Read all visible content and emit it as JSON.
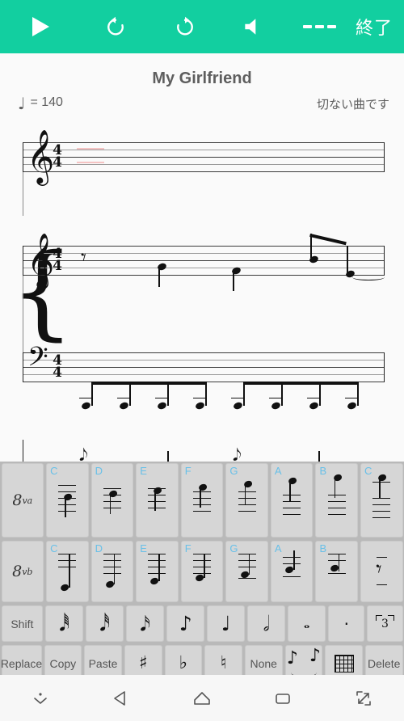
{
  "toolbar": {
    "play_label": "play-icon",
    "undo_label": "undo-icon",
    "redo_label": "redo-icon",
    "volume_label": "volume-icon",
    "dashes_label": "---",
    "exit_label": "終了",
    "background_color": "#12CFA0"
  },
  "score": {
    "title": "My Girlfriend",
    "tempo_note": "♩",
    "tempo_text": "= 140",
    "subtitle": "切ない曲です",
    "systems": [
      {
        "clef": "treble",
        "time_signature_top": "4",
        "time_signature_bottom": "4",
        "content": "empty measure with edit cursor"
      },
      {
        "clef": "treble",
        "time_signature_top": "4",
        "time_signature_bottom": "4",
        "content": "quarter rest, two quarter notes, two beamed eighth notes with tie"
      },
      {
        "clef": "bass",
        "time_signature_top": "4",
        "time_signature_bottom": "4",
        "content": "eight beamed eighth notes on ledger lines below staff"
      }
    ]
  },
  "keyboard": {
    "row_octave_up": {
      "octave_label": "8",
      "octave_sup": "va",
      "notes": [
        "C",
        "D",
        "E",
        "F",
        "G",
        "A",
        "B",
        "C"
      ]
    },
    "row_octave_down": {
      "octave_label": "8",
      "octave_sup": "vb",
      "notes": [
        "C",
        "D",
        "E",
        "F",
        "G",
        "A",
        "B"
      ],
      "rest_key": "quarter-rest"
    },
    "row_durations": {
      "shift_label": "Shift",
      "durations": [
        "sixty-fourth-note",
        "thirty-second-note",
        "sixteenth-note",
        "eighth-note",
        "quarter-note",
        "half-note",
        "whole-note",
        "dot",
        "triplet"
      ],
      "duration_glyphs": [
        "♬",
        "♬",
        "♫",
        "♪",
        "♩",
        "ᴕE",
        "ᴕD",
        "·",
        "3"
      ]
    },
    "row_actions": {
      "buttons": [
        {
          "name": "replace",
          "label": "Replace"
        },
        {
          "name": "copy",
          "label": "Copy"
        },
        {
          "name": "paste",
          "label": "Paste"
        },
        {
          "name": "sharp",
          "label": "♯"
        },
        {
          "name": "flat",
          "label": "♭"
        },
        {
          "name": "natural",
          "label": "♮"
        },
        {
          "name": "none",
          "label": "None"
        },
        {
          "name": "slur",
          "label": "slur-icon"
        },
        {
          "name": "chord-grid",
          "label": "grid-icon"
        },
        {
          "name": "delete",
          "label": "Delete"
        }
      ]
    },
    "note_letter_color": "#69c0e8",
    "key_background": "#d6d6d6",
    "panel_background": "#b9b9b9"
  },
  "navbar": {
    "items": [
      {
        "name": "hide-keyboard",
        "label": "hide-keyboard-icon"
      },
      {
        "name": "back",
        "label": "back-icon"
      },
      {
        "name": "home",
        "label": "home-icon"
      },
      {
        "name": "recents",
        "label": "recents-icon"
      },
      {
        "name": "fullscreen",
        "label": "fullscreen-icon"
      }
    ]
  }
}
